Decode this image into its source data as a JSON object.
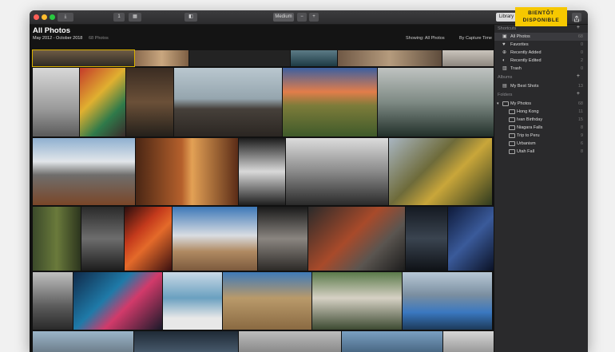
{
  "toolbar": {
    "btn_a": "1",
    "btn_b": "",
    "zoom_label": "Medium",
    "zoom_minus": "−",
    "zoom_plus": "+",
    "library_label": "Library"
  },
  "badge": {
    "line1": "BIENTÔT",
    "line2": "DISPONIBLE"
  },
  "header": {
    "title": "All Photos",
    "date_range": "May 2012 - October 2018",
    "count": "68 Photos",
    "showing": "Showing:  All Photos",
    "sort_by": "By Capture Time"
  },
  "sidebar": {
    "shortcuts_title": "Shortcuts",
    "albums_title": "Albums",
    "folders_title": "Folders",
    "shortcuts": [
      {
        "label": "All Photos",
        "count": "68",
        "icon": "photos-icon"
      },
      {
        "label": "Favorites",
        "count": "0",
        "icon": "heart-icon"
      },
      {
        "label": "Recently Added",
        "count": "0",
        "icon": "plus-circle-icon"
      },
      {
        "label": "Recently Edited",
        "count": "2",
        "icon": "edit-icon"
      },
      {
        "label": "Trash",
        "count": "0",
        "icon": "trash-icon"
      }
    ],
    "albums": [
      {
        "label": "My Best Shots",
        "count": "13"
      }
    ],
    "folders_root": {
      "label": "My Photos",
      "count": "68"
    },
    "folders": [
      {
        "label": "Hong Kong",
        "count": "11"
      },
      {
        "label": "Ivan Birthday",
        "count": "15"
      },
      {
        "label": "Niagara Falls",
        "count": "8"
      },
      {
        "label": "Trip to Peru",
        "count": "9"
      },
      {
        "label": "Urbanism",
        "count": "6"
      },
      {
        "label": "Utah Fall",
        "count": "8"
      }
    ]
  }
}
